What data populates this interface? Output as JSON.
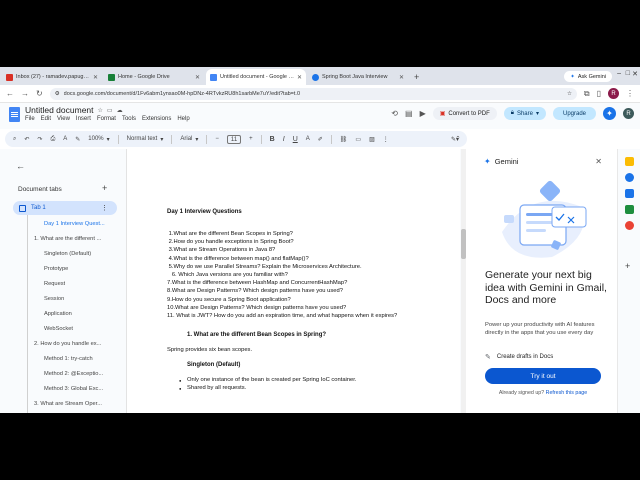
{
  "browser": {
    "tabs": [
      {
        "label": "Inbox (27) - ramadev.papuga@...",
        "color": "#d93025",
        "active": false
      },
      {
        "label": "Home - Google Drive",
        "color": "#188038",
        "active": false
      },
      {
        "label": "Untitled document - Google Do...",
        "color": "#4285f4",
        "active": true
      },
      {
        "label": "Spring Boot Java Interview",
        "color": "#1a73e8",
        "active": false
      }
    ],
    "new_tab": "+",
    "ask_gemini": "Ask Gemini",
    "url": "docs.google.com/document/d/1Fv6abm1ynsao0M-hpDNz-4RTvkzRU8h1sarbMe7uY/edit?tab=t.0",
    "profile_r": "R",
    "profile_k": "R"
  },
  "docs": {
    "title": "Untitled document",
    "menu": [
      "File",
      "Edit",
      "View",
      "Insert",
      "Format",
      "Tools",
      "Extensions",
      "Help"
    ],
    "convert_pdf": "Convert to PDF",
    "share": "Share",
    "upgrade": "Upgrade",
    "avatar": "R"
  },
  "toolbar": {
    "zoom": "100%",
    "style": "Normal text",
    "font": "Arial",
    "font_size": "11",
    "minus": "−",
    "plus": "+"
  },
  "left_panel": {
    "heading": "Document tabs",
    "tab_name": "Tab 1",
    "outline": [
      {
        "label": "Day 1 Interview Quest...",
        "indent": 1,
        "selected": true
      },
      {
        "label": "1. What are the different ...",
        "indent": 0,
        "selected": false
      },
      {
        "label": "Singleton (Default)",
        "indent": 1,
        "selected": false
      },
      {
        "label": "Prototype",
        "indent": 1,
        "selected": false
      },
      {
        "label": "Request",
        "indent": 1,
        "selected": false
      },
      {
        "label": "Session",
        "indent": 1,
        "selected": false
      },
      {
        "label": "Application",
        "indent": 1,
        "selected": false
      },
      {
        "label": "WebSocket",
        "indent": 1,
        "selected": false
      },
      {
        "label": "2. How do you handle ex...",
        "indent": 0,
        "selected": false
      },
      {
        "label": "Method 1: try-catch",
        "indent": 1,
        "selected": false
      },
      {
        "label": "Method 2: @Exceptio...",
        "indent": 1,
        "selected": false
      },
      {
        "label": "Method 3: Global Exc...",
        "indent": 1,
        "selected": false
      },
      {
        "label": "3. What are Stream Oper...",
        "indent": 0,
        "selected": false
      }
    ]
  },
  "document": {
    "heading": "Day 1 Interview Questions",
    "questions": [
      " 1.What are the different Bean Scopes in Spring?",
      " 2.How do you handle exceptions in Spring Boot?",
      " 3.What are Stream Operations in Java 8?",
      " 4.What is the difference between map() and flatMap()?",
      " 5.Why do we use Parallel Streams? Explain the Microservices Architecture.",
      "   6. Which Java versions are you familiar with?",
      "7.What is the difference between HashMap and ConcurrentHashMap?",
      "8.What are Design Patterns? Which design patterns have you used?",
      "9.How do you secure a Spring Boot application?",
      "10.What are Design Patterns? Which design patterns have you used?",
      "11. What is JWT? How do you add an expiration time, and what happens when it expires?"
    ],
    "section1_heading": "1. What are the different Bean Scopes in Spring?",
    "section1_intro": "Spring provides six bean scopes.",
    "sub1": "Singleton (Default)",
    "bullets": [
      "Only one instance of the bean is created per Spring IoC container.",
      "Shared by all requests."
    ]
  },
  "gemini": {
    "header": "Gemini",
    "title": "Generate your next big idea with Gemini in Gmail, Docs and more",
    "description": "Power up your productivity with AI features directly in the apps that you use every day",
    "feature": "Create drafts in Docs",
    "try_button": "Try it out",
    "signed_in_text": "Already signed up?",
    "refresh_link": "Refresh this page"
  },
  "colors": {
    "accent": "#0b57d0",
    "share_bg": "#c2e7ff",
    "toolbar_bg": "#edf2fa",
    "tab_selected": "#d3e3fd"
  }
}
